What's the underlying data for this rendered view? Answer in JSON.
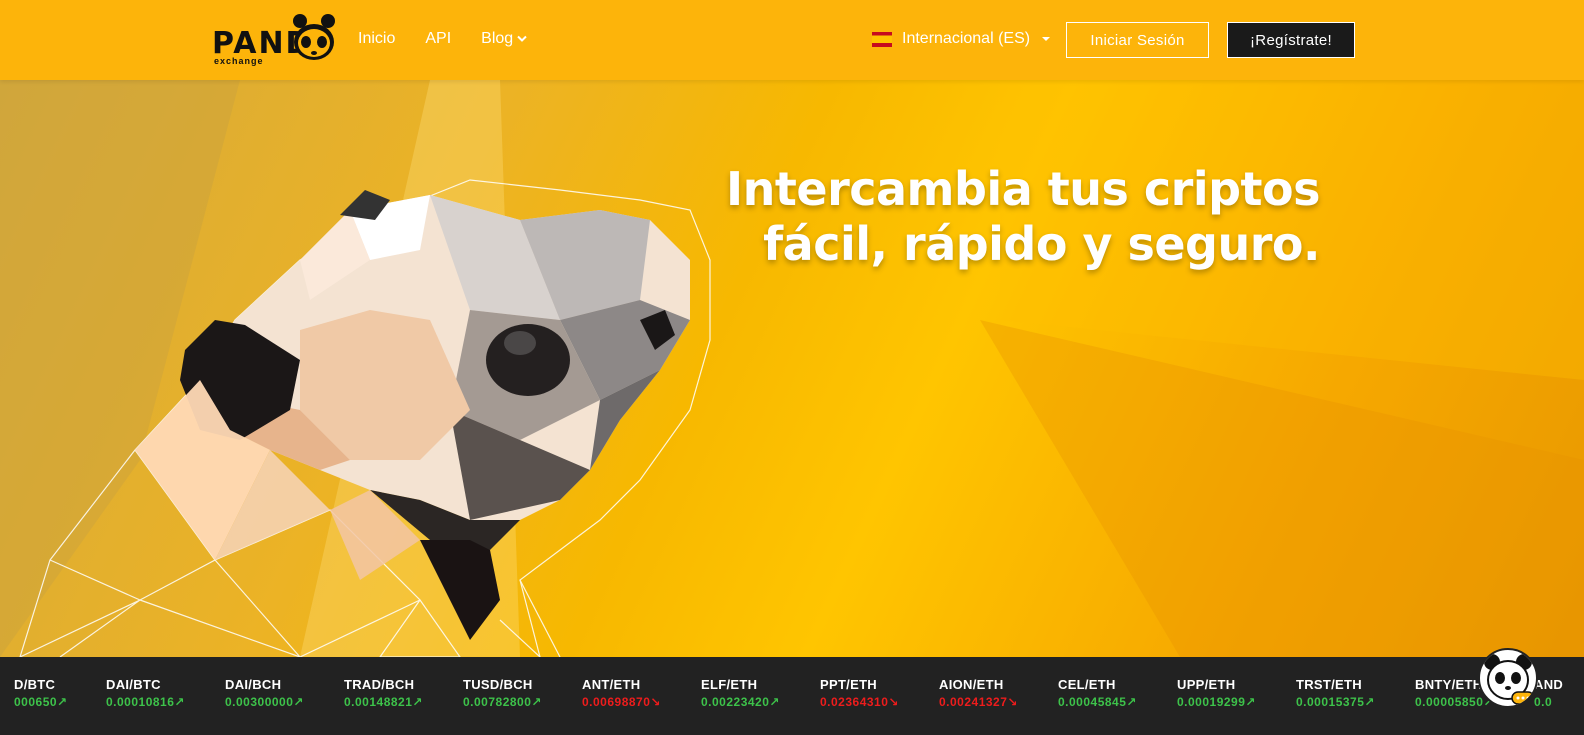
{
  "header": {
    "logo_text": "PAND",
    "logo_sub": "exchange",
    "nav": [
      {
        "label": "Inicio"
      },
      {
        "label": "API"
      },
      {
        "label": "Blog"
      }
    ],
    "language": "Internacional (ES)",
    "login_label": "Iniciar Sesión",
    "register_label": "¡Regístrate!"
  },
  "hero": {
    "title_line1": "Intercambia tus criptos",
    "title_line2": "fácil, rápido y seguro."
  },
  "ticker": [
    {
      "pair": "D/BTC",
      "price": "000650",
      "trend": "up"
    },
    {
      "pair": "DAI/BTC",
      "price": "0.00010816",
      "trend": "up"
    },
    {
      "pair": "DAI/BCH",
      "price": "0.00300000",
      "trend": "up"
    },
    {
      "pair": "TRAD/BCH",
      "price": "0.00148821",
      "trend": "up"
    },
    {
      "pair": "TUSD/BCH",
      "price": "0.00782800",
      "trend": "up"
    },
    {
      "pair": "ANT/ETH",
      "price": "0.00698870",
      "trend": "down"
    },
    {
      "pair": "ELF/ETH",
      "price": "0.00223420",
      "trend": "up"
    },
    {
      "pair": "PPT/ETH",
      "price": "0.02364310",
      "trend": "down"
    },
    {
      "pair": "AION/ETH",
      "price": "0.00241327",
      "trend": "down"
    },
    {
      "pair": "CEL/ETH",
      "price": "0.00045845",
      "trend": "up"
    },
    {
      "pair": "UPP/ETH",
      "price": "0.00019299",
      "trend": "up"
    },
    {
      "pair": "TRST/ETH",
      "price": "0.00015375",
      "trend": "up"
    },
    {
      "pair": "BNTY/ETH",
      "price": "0.00005850",
      "trend": "up"
    },
    {
      "pair": "AND",
      "price": "0.0",
      "trend": "up"
    }
  ],
  "colors": {
    "header_bg": "#fdb40a",
    "ticker_bg": "#222222",
    "up": "#3dc24a",
    "down": "#ee1c1c"
  },
  "icons": {
    "trend_up": "↗",
    "trend_down": "↘"
  }
}
